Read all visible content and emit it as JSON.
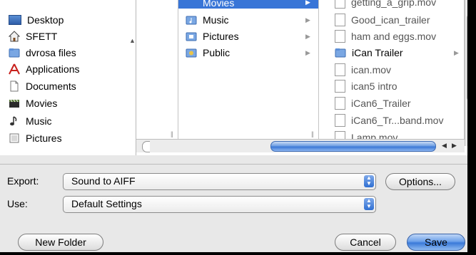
{
  "sidebar": {
    "items": [
      {
        "label": "Desktop",
        "icon": "desktop-icon"
      },
      {
        "label": "SFETT",
        "icon": "home-icon"
      },
      {
        "label": "dvrosa files",
        "icon": "folder-icon"
      },
      {
        "label": "Applications",
        "icon": "applications-icon"
      },
      {
        "label": "Documents",
        "icon": "documents-icon"
      },
      {
        "label": "Movies",
        "icon": "movies-icon"
      },
      {
        "label": "Music",
        "icon": "music-icon"
      },
      {
        "label": "Pictures",
        "icon": "pictures-icon"
      }
    ]
  },
  "column2": {
    "selected_label": "Movies",
    "items": [
      {
        "label": "Music",
        "icon": "music-folder-icon"
      },
      {
        "label": "Pictures",
        "icon": "pictures-folder-icon"
      },
      {
        "label": "Public",
        "icon": "public-folder-icon"
      }
    ]
  },
  "column3": {
    "items": [
      {
        "label": "getting_a_grip.mov",
        "icon": "movie-file-icon"
      },
      {
        "label": "Good_ican_trailer",
        "icon": "document-icon"
      },
      {
        "label": "ham and eggs.mov",
        "icon": "movie-file-icon"
      },
      {
        "label": "iCan Trailer",
        "icon": "folder-icon"
      },
      {
        "label": "ican.mov",
        "icon": "movie-file-icon"
      },
      {
        "label": "ican5 intro",
        "icon": "document-icon"
      },
      {
        "label": "iCan6_Trailer",
        "icon": "document-icon"
      },
      {
        "label": "iCan6_Tr...band.mov",
        "icon": "movie-file-icon"
      },
      {
        "label": "Lamp.mov",
        "icon": "movie-file-icon"
      }
    ]
  },
  "export": {
    "label": "Export:",
    "value": "Sound to AIFF",
    "options_button": "Options..."
  },
  "use": {
    "label": "Use:",
    "value": "Default Settings"
  },
  "buttons": {
    "new_folder": "New Folder",
    "cancel": "Cancel",
    "save": "Save"
  },
  "colors": {
    "selection": "#3875d7",
    "default_button": "#3a7ad9"
  }
}
